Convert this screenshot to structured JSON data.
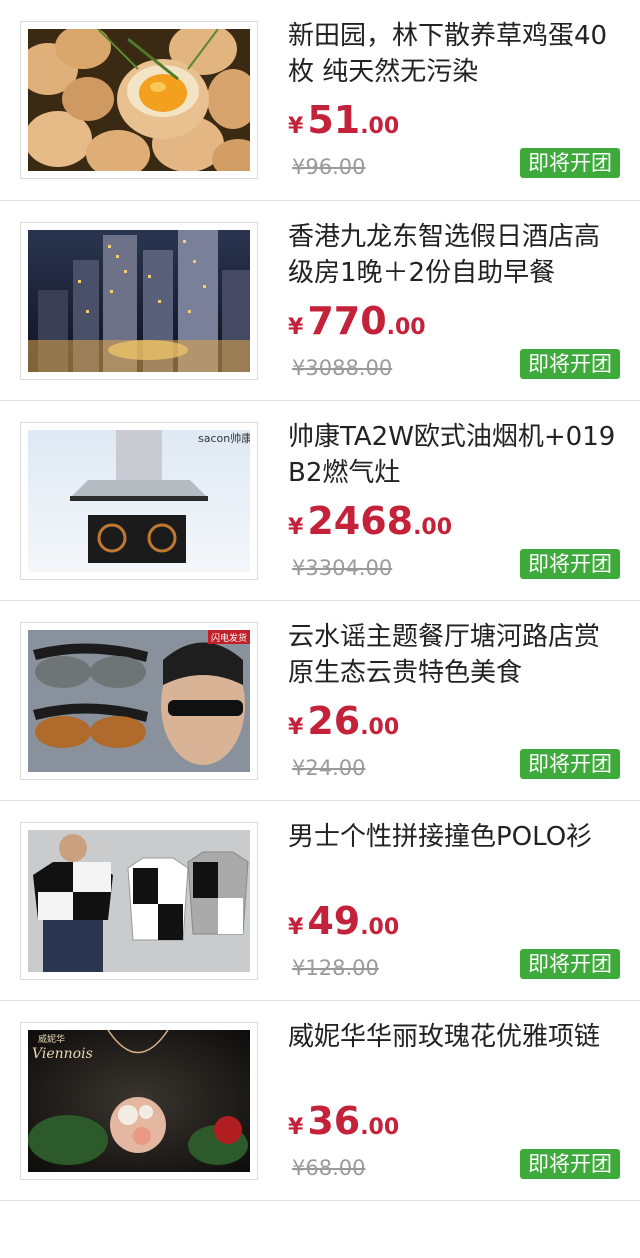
{
  "currency_symbol": "¥",
  "button_color": "#3daa3b",
  "price_color": "#c4213a",
  "products": [
    {
      "title": "新田园，林下散养草鸡蛋40枚 纯天然无污染",
      "price_int": "51",
      "price_dec": ".00",
      "old_price": "¥96.00",
      "button_label": "即将开团"
    },
    {
      "title": "香港九龙东智选假日酒店高级房1晚＋2份自助早餐",
      "price_int": "770",
      "price_dec": ".00",
      "old_price": "¥3088.00",
      "button_label": "即将开团"
    },
    {
      "title": "帅康TA2W欧式油烟机+019B2燃气灶",
      "price_int": "2468",
      "price_dec": ".00",
      "old_price": "¥3304.00",
      "button_label": "即将开团"
    },
    {
      "title": "云水谣主题餐厅塘河路店赏原生态云贵特色美食",
      "price_int": "26",
      "price_dec": ".00",
      "old_price": "¥24.00",
      "button_label": "即将开团"
    },
    {
      "title": "男士个性拼接撞色POLO衫",
      "price_int": "49",
      "price_dec": ".00",
      "old_price": "¥128.00",
      "button_label": "即将开团"
    },
    {
      "title": "威妮华华丽玫瑰花优雅项链",
      "price_int": "36",
      "price_dec": ".00",
      "old_price": "¥68.00",
      "button_label": "即将开团"
    }
  ],
  "image_texts": {
    "hood_brand": "sacon帅康",
    "banner_tag": "闪电发货",
    "necklace_brand_cn": "威妮华",
    "necklace_brand_en": "Viennois"
  }
}
